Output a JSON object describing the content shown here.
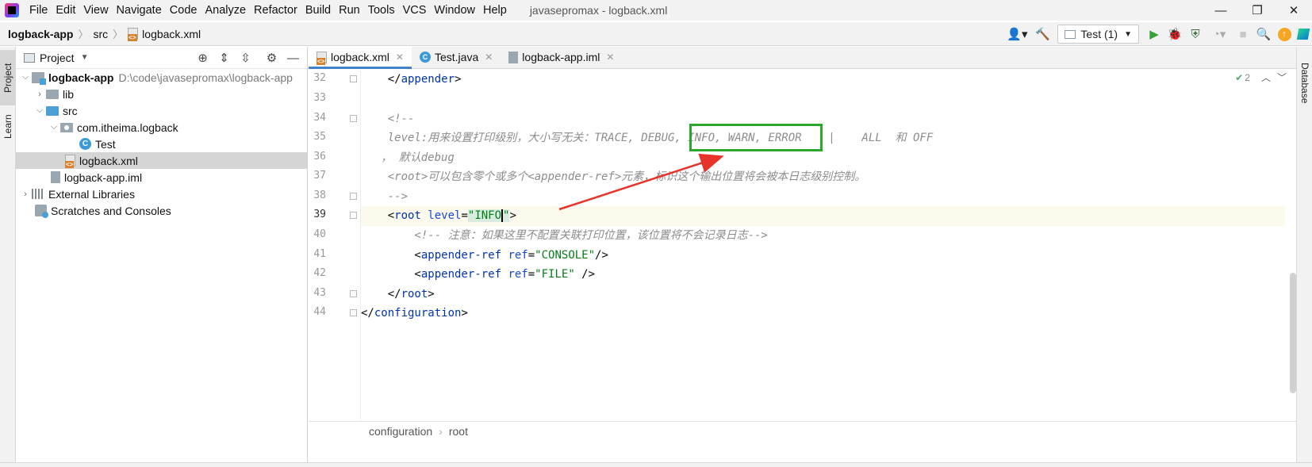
{
  "window": {
    "title": "javasepromax - logback.xml",
    "minimize": "—",
    "restore": "❐",
    "close": "✕"
  },
  "menu": [
    "File",
    "Edit",
    "View",
    "Navigate",
    "Code",
    "Analyze",
    "Refactor",
    "Build",
    "Run",
    "Tools",
    "VCS",
    "Window",
    "Help"
  ],
  "nav": {
    "crumbs": [
      "logback-app",
      "src",
      "logback.xml"
    ],
    "run_config": "Test (1)"
  },
  "side_tabs": {
    "project": "Project",
    "learn": "Learn",
    "database": "Database"
  },
  "project_panel": {
    "title": "Project",
    "tree": [
      {
        "label": "logback-app",
        "path": "D:\\code\\javasepromax\\logback-app"
      },
      {
        "label": "lib"
      },
      {
        "label": "src"
      },
      {
        "label": "com.itheima.logback"
      },
      {
        "label": "Test"
      },
      {
        "label": "logback.xml"
      },
      {
        "label": "logback-app.iml"
      },
      {
        "label": "External Libraries"
      },
      {
        "label": "Scratches and Consoles"
      }
    ]
  },
  "editor": {
    "tabs": [
      {
        "label": "logback.xml"
      },
      {
        "label": "Test.java"
      },
      {
        "label": "logback-app.iml"
      }
    ],
    "inspection_count": "2",
    "line_numbers": [
      "32",
      "33",
      "34",
      "35",
      "36",
      "37",
      "38",
      "39",
      "40",
      "41",
      "42",
      "43",
      "44"
    ],
    "code": {
      "l32_open": "    </",
      "l32_tag": "appender",
      "l32_close": ">",
      "l34": "    <!--",
      "l35": "    level:用来设置打印级别，大小写无关：TRACE, DEBUG, INFO, WARN, ERROR    |    ALL  和 OFF",
      "l36": "   ， 默认debug",
      "l37": "    <root>可以包含零个或多个<appender-ref>元素，标识这个输出位置将会被本日志级别控制。",
      "l38": "    -->",
      "l39_indent": "    <",
      "l39_tag": "root",
      "l39_attr": " level",
      "l39_eq": "=",
      "l39_val_a": "\"INFO",
      "l39_val_b": "\"",
      "l39_close": ">",
      "l40": "        <!-- 注意：如果这里不配置关联打印位置，该位置将不会记录日志-->",
      "l41_a": "        <",
      "l41_tag": "appender-ref",
      "l41_attr": " ref",
      "l41_eq": "=",
      "l41_val": "\"CONSOLE\"",
      "l41_close": "/>",
      "l42_a": "        <",
      "l42_tag": "appender-ref",
      "l42_attr": " ref",
      "l42_eq": "=",
      "l42_val": "\"FILE\"",
      "l42_close": " />",
      "l43_a": "    </",
      "l43_tag": "root",
      "l43_close": ">",
      "l44_a": "</",
      "l44_tag": "configuration",
      "l44_close": ">"
    },
    "breadcrumb": [
      "configuration",
      "root"
    ]
  },
  "colors": {
    "annotation_box": "#2aa82a",
    "annotation_arrow": "#e8332a",
    "tab_underline": "#4083c9"
  }
}
